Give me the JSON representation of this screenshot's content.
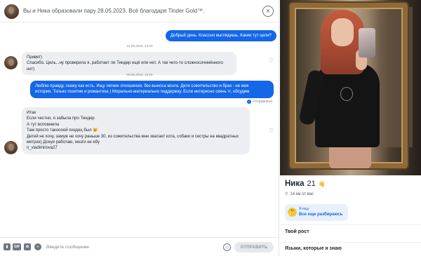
{
  "header": {
    "match_text": "Вы и Ника образовали пару 28.05.2023. Всё благодаря Tinder Gold™.",
    "close_glyph": "×"
  },
  "messages": [
    {
      "dir": "out",
      "text": "Добрый день. Классно выглядишь. Какие тут цели?"
    },
    {
      "stamp": "31.05.2023, 23:00"
    },
    {
      "dir": "in",
      "lines": [
        "Привет)",
        "Спасибо. Цель...ну проверила я, работает ли Тиндер ещё или нет. А так чего-то сложносочинённого нет)"
      ]
    },
    {
      "stamp": "05.06.2023, 15:29"
    },
    {
      "dir": "out",
      "lines": [
        "Люблю правду, скажу как есть. Ищу легкие отношения, без выноса мозга. Дети сожительство и брак - не моя",
        "история. Только позитив и романтика ) Морально-материально поддержку. Если интересно скинь тг, обсудим"
      ]
    },
    {
      "status": "Отправлено"
    },
    {
      "dir": "in",
      "lines": [
        "Итак",
        "Если честно, я забыла про Тиндер",
        "А тут вспомнила",
        "Там просто такоооой пиздец был 😿",
        "Детей не хочу, замуж не хочу раньше 30, из сожительства мне хватает кота, собаки и сестры на квадратных",
        "метрах) Дохуя работаю, мозги не ебу",
        "n_vladimirova27"
      ]
    }
  ],
  "composer": {
    "placeholder": "Введите сообщение",
    "send_label": "ОТПРАВИТЬ",
    "tools": [
      "image-icon",
      "gif-icon",
      "sticker-icon",
      "emoji-menu-icon"
    ],
    "tool_glyphs": [
      "▮",
      "GIF",
      "✿",
      "≡"
    ],
    "emoji_glyph": "☺"
  },
  "profile": {
    "name": "Ника",
    "age": "21",
    "distance": "14 км от вас",
    "looking_label": "Я ищу",
    "looking_value": "Все еще разбираюсь",
    "looking_emoji": "🤔",
    "sections": [
      "Твой рост",
      "Языки, которые я знаю"
    ]
  },
  "colors": {
    "accent": "#1467e6",
    "bubble_in": "#eceef2",
    "send_disabled": "#e6e8ec"
  }
}
